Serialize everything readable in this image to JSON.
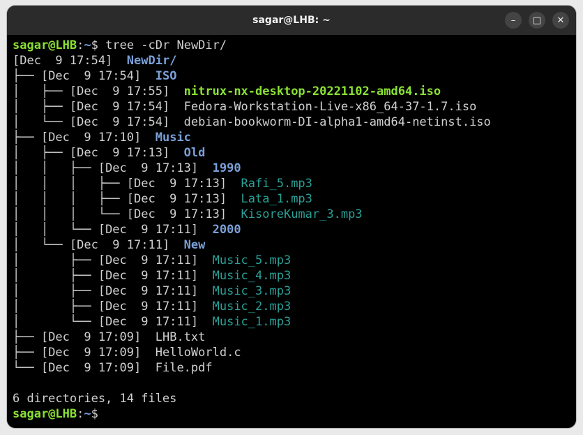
{
  "window": {
    "title": "sagar@LHB: ~"
  },
  "prompt": {
    "user": "sagar@LHB",
    "path": "~",
    "symbol": "$"
  },
  "command": "tree -cDr NewDir/",
  "tree": [
    {
      "prefix": "",
      "stamp": "[Dec  9 17:54]",
      "name": "NewDir/",
      "type": "dir"
    },
    {
      "prefix": "├── ",
      "stamp": "[Dec  9 17:54]",
      "name": "ISO",
      "type": "dir"
    },
    {
      "prefix": "│   ├── ",
      "stamp": "[Dec  9 17:55]",
      "name": "nitrux-nx-desktop-20221102-amd64.iso",
      "type": "iso"
    },
    {
      "prefix": "│   ├── ",
      "stamp": "[Dec  9 17:54]",
      "name": "Fedora-Workstation-Live-x86_64-37-1.7.iso",
      "type": "plain"
    },
    {
      "prefix": "│   └── ",
      "stamp": "[Dec  9 17:54]",
      "name": "debian-bookworm-DI-alpha1-amd64-netinst.iso",
      "type": "plain"
    },
    {
      "prefix": "├── ",
      "stamp": "[Dec  9 17:10]",
      "name": "Music",
      "type": "dir"
    },
    {
      "prefix": "│   ├── ",
      "stamp": "[Dec  9 17:13]",
      "name": "Old",
      "type": "dir"
    },
    {
      "prefix": "│   │   ├── ",
      "stamp": "[Dec  9 17:13]",
      "name": "1990",
      "type": "dir"
    },
    {
      "prefix": "│   │   │   ├── ",
      "stamp": "[Dec  9 17:13]",
      "name": "Rafi_5.mp3",
      "type": "mp3"
    },
    {
      "prefix": "│   │   │   ├── ",
      "stamp": "[Dec  9 17:13]",
      "name": "Lata_1.mp3",
      "type": "mp3"
    },
    {
      "prefix": "│   │   │   └── ",
      "stamp": "[Dec  9 17:13]",
      "name": "KisoreKumar_3.mp3",
      "type": "mp3"
    },
    {
      "prefix": "│   │   └── ",
      "stamp": "[Dec  9 17:11]",
      "name": "2000",
      "type": "dir"
    },
    {
      "prefix": "│   └── ",
      "stamp": "[Dec  9 17:11]",
      "name": "New",
      "type": "dir"
    },
    {
      "prefix": "│       ├── ",
      "stamp": "[Dec  9 17:11]",
      "name": "Music_5.mp3",
      "type": "mp3"
    },
    {
      "prefix": "│       ├── ",
      "stamp": "[Dec  9 17:11]",
      "name": "Music_4.mp3",
      "type": "mp3"
    },
    {
      "prefix": "│       ├── ",
      "stamp": "[Dec  9 17:11]",
      "name": "Music_3.mp3",
      "type": "mp3"
    },
    {
      "prefix": "│       ├── ",
      "stamp": "[Dec  9 17:11]",
      "name": "Music_2.mp3",
      "type": "mp3"
    },
    {
      "prefix": "│       └── ",
      "stamp": "[Dec  9 17:11]",
      "name": "Music_1.mp3",
      "type": "mp3"
    },
    {
      "prefix": "├── ",
      "stamp": "[Dec  9 17:09]",
      "name": "LHB.txt",
      "type": "plain"
    },
    {
      "prefix": "├── ",
      "stamp": "[Dec  9 17:09]",
      "name": "HelloWorld.c",
      "type": "plain"
    },
    {
      "prefix": "└── ",
      "stamp": "[Dec  9 17:09]",
      "name": "File.pdf",
      "type": "plain"
    }
  ],
  "summary": "6 directories, 14 files",
  "colors": {
    "user": "#8ae234",
    "dir": "#7aa0d8",
    "iso": "#8ae234",
    "mp3": "#2aa198",
    "text": "#d0d0d0"
  },
  "icons": {
    "minimize": "minimize-icon",
    "maximize": "maximize-icon",
    "close": "close-icon"
  }
}
